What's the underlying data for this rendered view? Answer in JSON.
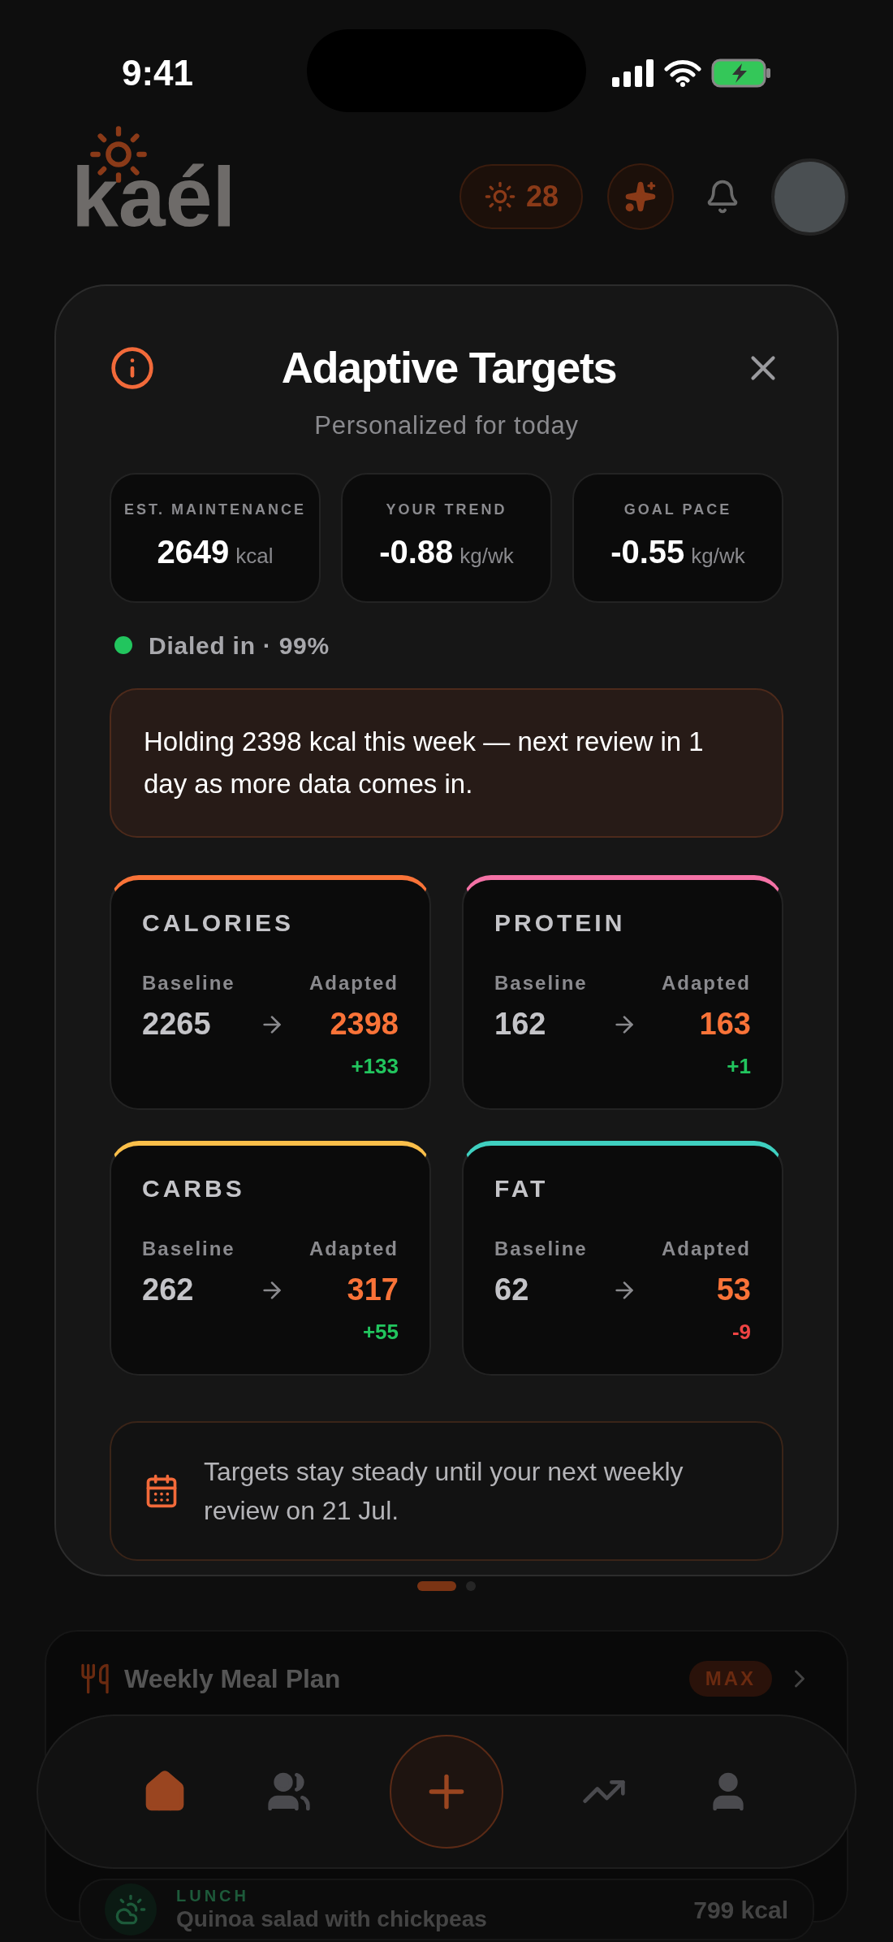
{
  "status_bar": {
    "time": "9:41"
  },
  "header": {
    "logo": "kaél",
    "streak": "28"
  },
  "modal": {
    "title": "Adaptive Targets",
    "subtitle": "Personalized for today",
    "stats": [
      {
        "label": "EST. MAINTENANCE",
        "value": "2649",
        "unit": "kcal"
      },
      {
        "label": "YOUR TREND",
        "value": "-0.88",
        "unit": "kg/wk"
      },
      {
        "label": "GOAL PACE",
        "value": "-0.55",
        "unit": "kg/wk"
      }
    ],
    "status": {
      "text": "Dialed in · 99%",
      "color": "#22c55e"
    },
    "note": "Holding 2398 kcal this week — next review in 1 day as more data comes in.",
    "macros": [
      {
        "name": "CALORIES",
        "color": "#f97338",
        "baseline_label": "Baseline",
        "baseline": "2265",
        "adapted_label": "Adapted",
        "adapted": "2398",
        "delta": "+133",
        "decrease": false
      },
      {
        "name": "PROTEIN",
        "color": "#f472a6",
        "baseline_label": "Baseline",
        "baseline": "162",
        "adapted_label": "Adapted",
        "adapted": "163",
        "delta": "+1",
        "decrease": false
      },
      {
        "name": "CARBS",
        "color": "#fbbf4a",
        "baseline_label": "Baseline",
        "baseline": "262",
        "adapted_label": "Adapted",
        "adapted": "317",
        "delta": "+55",
        "decrease": false
      },
      {
        "name": "FAT",
        "color": "#3fd0c0",
        "baseline_label": "Baseline",
        "baseline": "62",
        "adapted_label": "Adapted",
        "adapted": "53",
        "delta": "-9",
        "decrease": true
      }
    ],
    "footer": "Targets stay steady until your next weekly review on 21 Jul."
  },
  "pager": [
    {
      "selected": true
    },
    {
      "selected": false
    }
  ],
  "meal_plan": {
    "title": "Weekly Meal Plan",
    "badge": "MAX",
    "meal": {
      "label": "LUNCH",
      "name": "Quinoa salad with chickpeas",
      "kcal": "799 kcal"
    }
  },
  "nav": [
    {
      "kind": "home",
      "selected": true
    },
    {
      "kind": "community",
      "selected": false
    },
    {
      "kind": "add",
      "selected": false
    },
    {
      "kind": "progress",
      "selected": false
    },
    {
      "kind": "profile",
      "selected": false
    }
  ]
}
